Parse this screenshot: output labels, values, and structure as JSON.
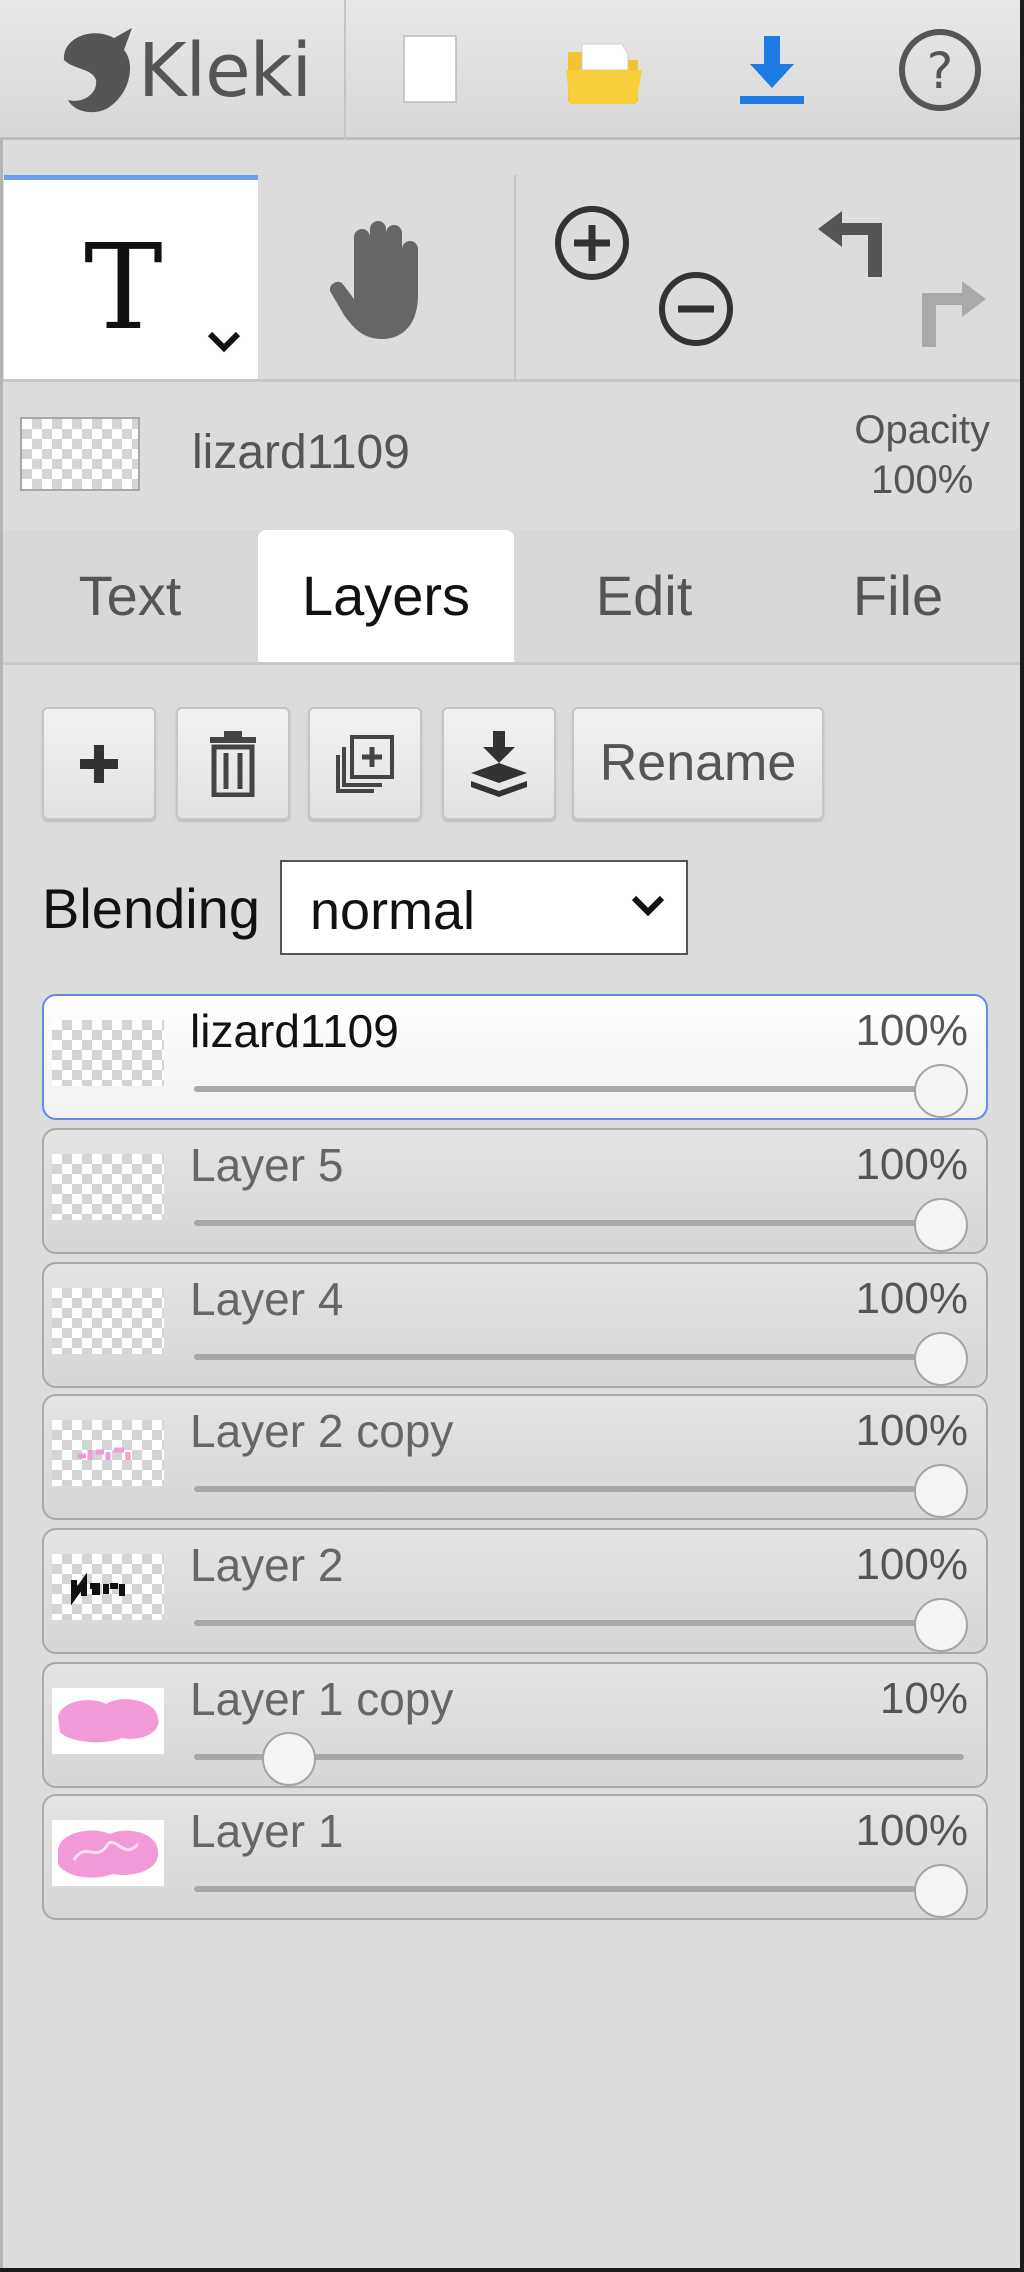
{
  "app": {
    "name": "Kleki"
  },
  "toolbar": {
    "active_tool": "text",
    "tools": [
      "text-tool",
      "hand-tool",
      "zoom-in",
      "zoom-out",
      "undo",
      "redo"
    ]
  },
  "layer_info": {
    "name": "lizard1109",
    "opacity_label": "Opacity",
    "opacity_value": "100%"
  },
  "tabs": [
    {
      "label": "Text",
      "active": false
    },
    {
      "label": "Layers",
      "active": true
    },
    {
      "label": "Edit",
      "active": false
    },
    {
      "label": "File",
      "active": false
    }
  ],
  "layer_actions": {
    "add_icon": "plus-icon",
    "delete_icon": "trash-icon",
    "duplicate_icon": "duplicate-icon",
    "merge_icon": "merge-down-icon",
    "rename_label": "Rename"
  },
  "blending": {
    "label": "Blending",
    "value": "normal"
  },
  "layers": [
    {
      "name": "lizard1109",
      "opacity": "100%",
      "opacity_value": 1.0,
      "selected": true,
      "thumb": "transparent"
    },
    {
      "name": "Layer 5",
      "opacity": "100%",
      "opacity_value": 1.0,
      "selected": false,
      "thumb": "transparent"
    },
    {
      "name": "Layer 4",
      "opacity": "100%",
      "opacity_value": 1.0,
      "selected": false,
      "thumb": "transparent"
    },
    {
      "name": "Layer 2 copy",
      "opacity": "100%",
      "opacity_value": 1.0,
      "selected": false,
      "thumb": "pink-text"
    },
    {
      "name": "Layer 2",
      "opacity": "100%",
      "opacity_value": 1.0,
      "selected": false,
      "thumb": "black-text"
    },
    {
      "name": "Layer 1 copy",
      "opacity": "10%",
      "opacity_value": 0.1,
      "selected": false,
      "thumb": "pink-cloud"
    },
    {
      "name": "Layer 1",
      "opacity": "100%",
      "opacity_value": 1.0,
      "selected": false,
      "thumb": "pink-scribble"
    }
  ],
  "colors": {
    "accent": "#5d8fe6",
    "download": "#1e7be6",
    "folder": "#f2c230",
    "pink": "#f29ad8"
  }
}
